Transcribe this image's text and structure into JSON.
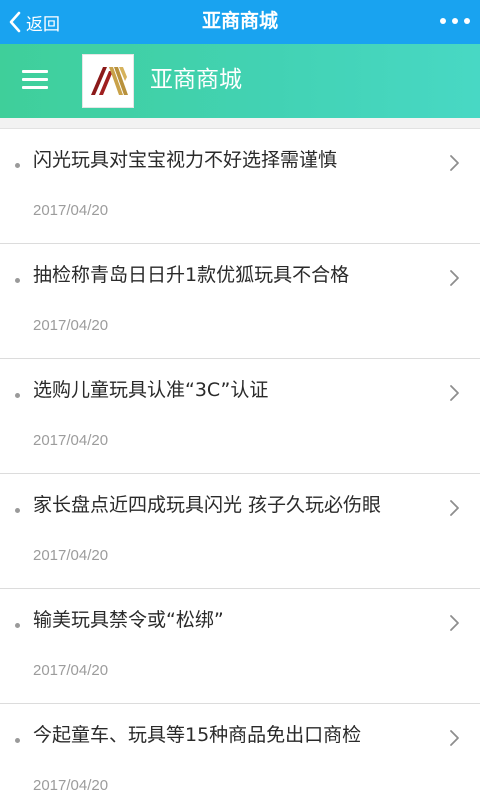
{
  "nav": {
    "back_label": "返回",
    "title": "亚商商城",
    "more_icon": "more-dots-icon"
  },
  "brand": {
    "name": "亚商商城",
    "menu_icon": "hamburger-menu-icon",
    "logo_icon": "brand-logo-icon",
    "colors": {
      "nav_bg": "#19a3f0",
      "brand_gradient_start": "#3fcf9a",
      "brand_gradient_end": "#48d8c4"
    }
  },
  "articles": [
    {
      "title": "闪光玩具对宝宝视力不好选择需谨慎",
      "date": "2017/04/20"
    },
    {
      "title": "抽检称青岛日日升1款优狐玩具不合格",
      "date": "2017/04/20"
    },
    {
      "title": "选购儿童玩具认准“3C”认证",
      "date": "2017/04/20"
    },
    {
      "title": "家长盘点近四成玩具闪光 孩子久玩必伤眼",
      "date": "2017/04/20"
    },
    {
      "title": "输美玩具禁令或“松绑”",
      "date": "2017/04/20"
    },
    {
      "title": "今起童车、玩具等15种商品免出口商检",
      "date": "2017/04/20"
    }
  ]
}
